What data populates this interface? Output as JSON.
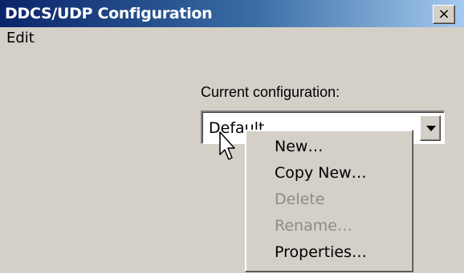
{
  "window": {
    "title": "DDCS/UDP Configuration",
    "close_label": "×"
  },
  "menubar": {
    "items": [
      "Edit"
    ]
  },
  "config": {
    "label": "Current configuration:",
    "value": "Default"
  },
  "context_menu": {
    "items": [
      {
        "label": "New…",
        "enabled": true
      },
      {
        "label": "Copy New…",
        "enabled": true
      },
      {
        "label": "Delete",
        "enabled": false
      },
      {
        "label": "Rename…",
        "enabled": false
      },
      {
        "label": "Properties…",
        "enabled": true
      }
    ]
  },
  "icons": {
    "close": "close-icon",
    "dropdown": "chevron-down-icon",
    "cursor": "mouse-pointer-icon"
  },
  "colors": {
    "titlebar_start": "#0a246a",
    "titlebar_end": "#a6caf0",
    "face": "#d4d0c8",
    "disabled_text": "#8e8c86"
  }
}
